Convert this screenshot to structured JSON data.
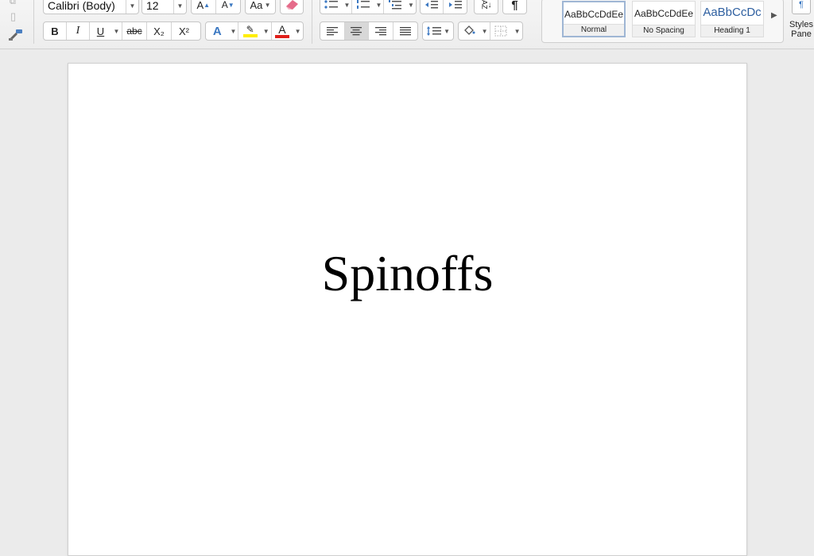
{
  "ribbon": {
    "font_name": "Calibri (Body)",
    "font_size": "12",
    "format": {
      "bold": "B",
      "italic": "I",
      "underline": "U",
      "strikethrough": "abc",
      "subscript": "X₂",
      "superscript": "X²",
      "text_effects": "A",
      "highlight": "✎",
      "font_color": "A"
    },
    "grow_font": "A",
    "shrink_font": "A",
    "change_case": "Aa",
    "paragraph_mark": "¶",
    "sort": "AZ",
    "colors": {
      "highlight": "#ffee00",
      "font_color": "#e0201b",
      "text_effects": "#3b78c2",
      "heading_blue": "#2e5fa0"
    },
    "styles": [
      {
        "sample": "AaBbCcDdEe",
        "name": "Normal"
      },
      {
        "sample": "AaBbCcDdEe",
        "name": "No Spacing"
      },
      {
        "sample": "AaBbCcDc",
        "name": "Heading 1"
      }
    ],
    "styles_pane_line1": "Styles",
    "styles_pane_line2": "Pane"
  },
  "document": {
    "text": "Spinoffs"
  }
}
